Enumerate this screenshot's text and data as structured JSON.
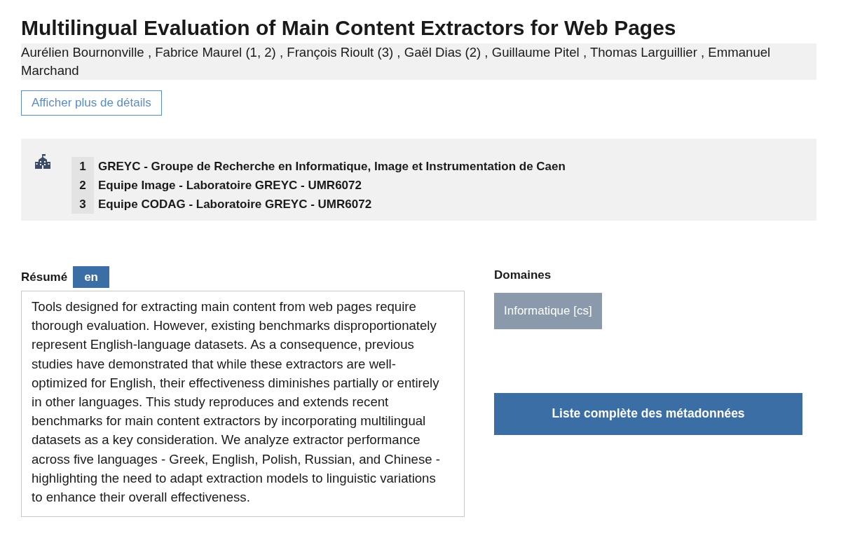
{
  "title": "Multilingual Evaluation of Main Content Extractors for Web Pages",
  "authors": "Aurélien Bournonville , Fabrice Maurel (1, 2) , François Rioult (3) , Gaël Dias (2) , Guillaume Pitel , Thomas Larguillier , Emmanuel Marchand",
  "details_button": "Afficher plus de détails",
  "affiliations": [
    {
      "number": "1",
      "name": "GREYC - Groupe de Recherche en Informatique, Image et Instrumentation de Caen"
    },
    {
      "number": "2",
      "name": "Equipe Image - Laboratoire GREYC - UMR6072"
    },
    {
      "number": "3",
      "name": "Equipe CODAG - Laboratoire GREYC - UMR6072"
    }
  ],
  "abstract": {
    "label": "Résumé",
    "languages": [
      {
        "label": "en",
        "selected": true
      }
    ],
    "text": "Tools designed for extracting main content from web pages require thorough evaluation. However, existing benchmarks disproportionately represent English-language datasets. As a consequence, previous studies have demonstrated that while these extractors are well-optimized for English, their effectiveness diminishes partially or entirely in other languages. This study reproduces and extends recent benchmarks for main content extractors by incorporating multilingual datasets as a key consideration. We analyze extractor performance across five languages - Greek, English, Polish, Russian, and Chinese - highlighting the need to adapt extraction models to linguistic variations to enhance their overall effectiveness."
  },
  "domains": {
    "label": "Domaines",
    "items": [
      "Informatique [cs]"
    ]
  },
  "metadata_button": "Liste complète des métadonnées"
}
